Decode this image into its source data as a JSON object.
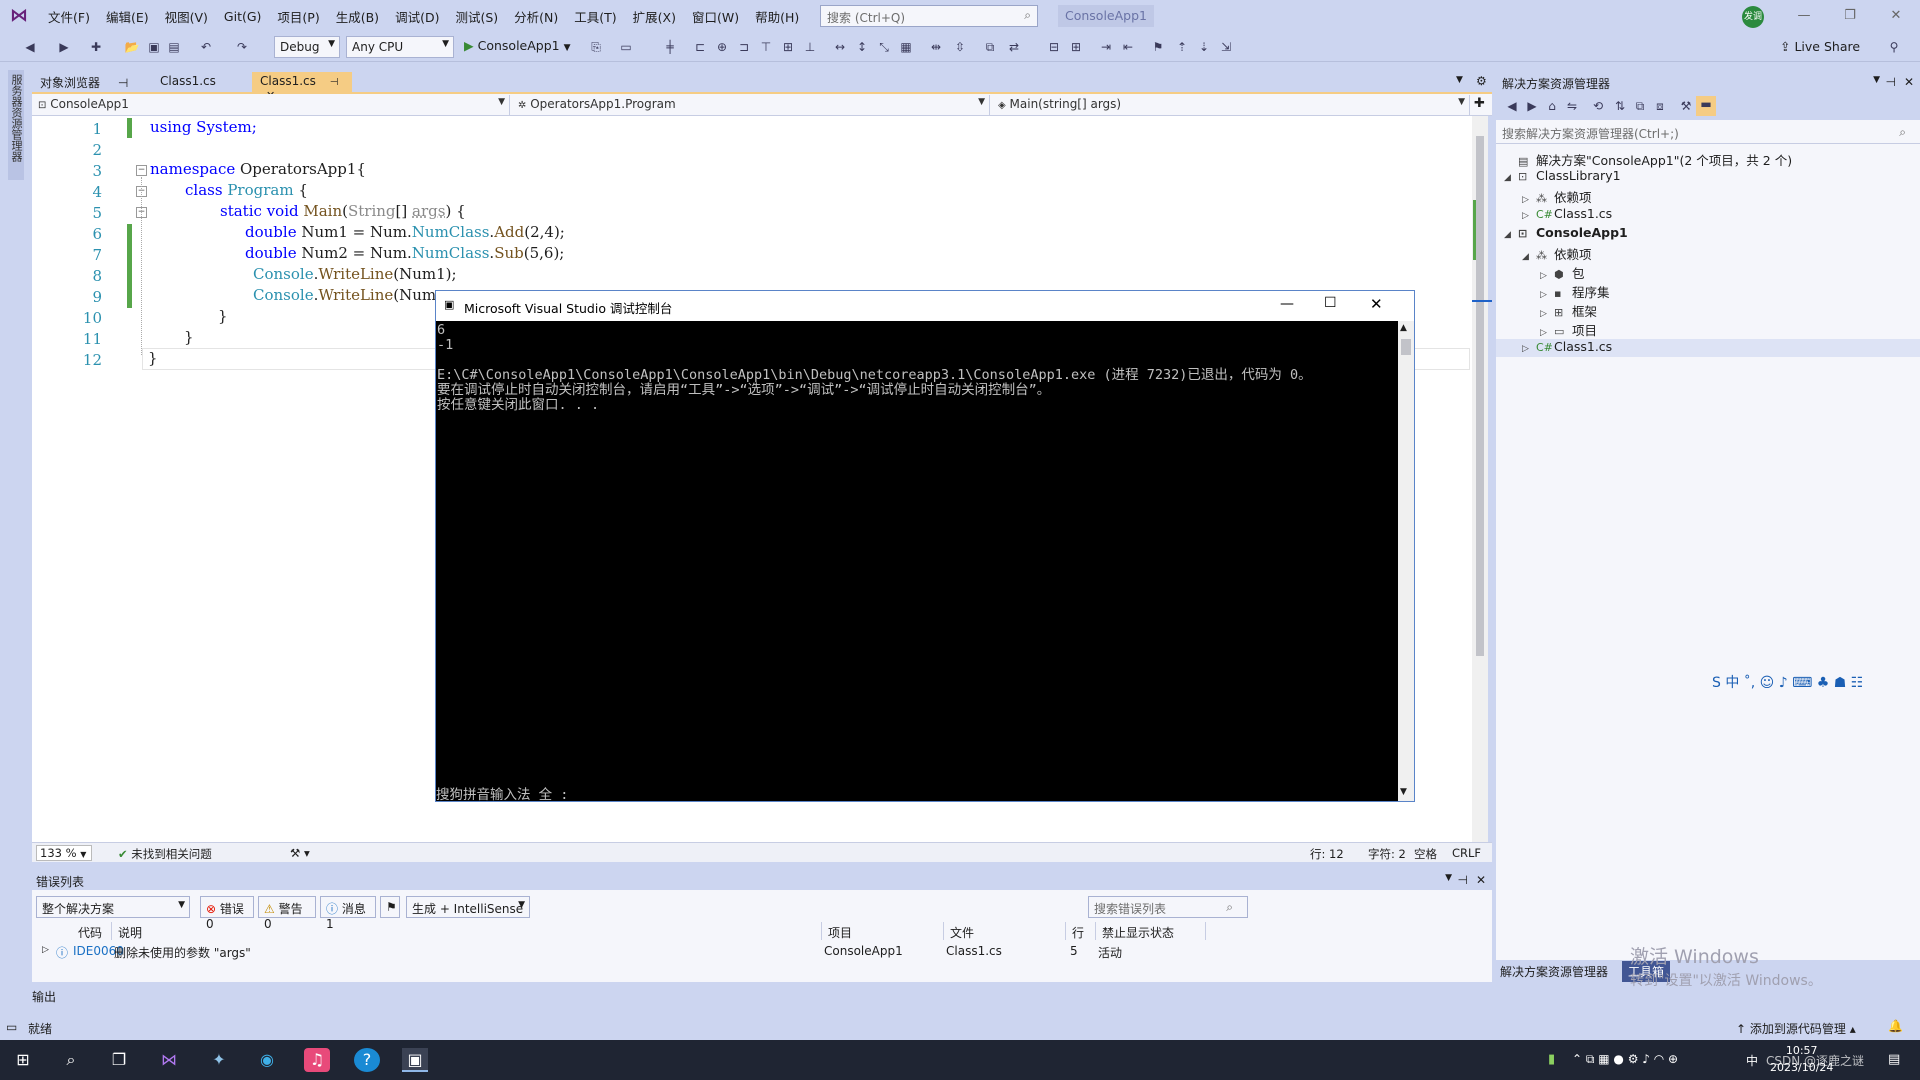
{
  "menubar": {
    "items": [
      "文件(F)",
      "编辑(E)",
      "视图(V)",
      "Git(G)",
      "项目(P)",
      "生成(B)",
      "调试(D)",
      "测试(S)",
      "分析(N)",
      "工具(T)",
      "扩展(X)",
      "窗口(W)",
      "帮助(H)"
    ],
    "search_placeholder": "搜索 (Ctrl+Q)",
    "app_title": "ConsoleApp1",
    "avatar_text": "发调"
  },
  "toolbar": {
    "config": "Debug",
    "platform": "Any CPU",
    "run_target": "ConsoleApp1",
    "live_share": "Live Share"
  },
  "left_rail": {
    "label": "服务器资源管理器"
  },
  "doc_tabs": [
    {
      "label": "对象浏览器",
      "pin": "ᵒ"
    },
    {
      "label": "Class1.cs"
    },
    {
      "label": "Class1.cs",
      "pin": "ᵒ",
      "close": "✕"
    }
  ],
  "nav": {
    "project": "ConsoleApp1",
    "class": "OperatorsApp1.Program",
    "member": "Main(string[] args)"
  },
  "code_lines": [
    "1",
    "2",
    "3",
    "4",
    "5",
    "6",
    "7",
    "8",
    "9",
    "10",
    "11",
    "12"
  ],
  "code": {
    "l1": "using System;",
    "l3_kw": "namespace",
    "l3_rest": " OperatorsApp1{",
    "l4_kw": "class",
    "l4_ty": "Program",
    "l4_rest": " {",
    "l5_kw1": "static",
    "l5_kw2": "void",
    "l5_me": "Main",
    "l5_p1": "(",
    "l5_ty": "String",
    "l5_p2": "[] ",
    "l5_pa": "args",
    "l5_p3": ") {",
    "l6_kw": "double",
    "l6_rest1": " Num1 = Num.",
    "l6_ty": "NumClass",
    "l6_p": ".",
    "l6_me": "Add",
    "l6_rest2": "(2,4);",
    "l7_kw": "double",
    "l7_rest1": " Num2 = Num.",
    "l7_ty": "NumClass",
    "l7_p": ".",
    "l7_me": "Sub",
    "l7_rest2": "(5,6);",
    "l8_ty": "Console",
    "l8_p": ".",
    "l8_me": "WriteLine",
    "l8_rest": "(Num1);",
    "l9_ty": "Console",
    "l9_p": ".",
    "l9_me": "WriteLine",
    "l9_rest": "(Num",
    "l10": "}",
    "l11": "}",
    "l12": "}"
  },
  "editor_status": {
    "zoom": "133 %",
    "issues": "未找到相关问题",
    "line": "行: 12",
    "char": "字符: 2",
    "space": "空格",
    "eol": "CRLF"
  },
  "console": {
    "title": "Microsoft Visual Studio 调试控制台",
    "output": "6\n-1\n\nE:\\C#\\ConsoleApp1\\ConsoleApp1\\ConsoleApp1\\bin\\Debug\\netcoreapp3.1\\ConsoleApp1.exe (进程 7232)已退出，代码为 0。\n要在调试停止时自动关闭控制台，请启用“工具”->“选项”->“调试”->“调试停止时自动关闭控制台”。\n按任意键关闭此窗口. . .",
    "ime_line": "搜狗拼音输入法 全 :"
  },
  "error_list": {
    "title": "错误列表",
    "scope": "整个解决方案",
    "errors": "错误 0",
    "warnings": "警告 0",
    "messages": "消息 1",
    "build_filter": "生成 + IntelliSense",
    "search_placeholder": "搜索错误列表",
    "columns": [
      "代码",
      "说明",
      "项目",
      "文件",
      "行",
      "禁止显示状态"
    ],
    "row": {
      "code": "IDE0060",
      "desc": "删除未使用的参数 \"args\"",
      "project": "ConsoleApp1",
      "file": "Class1.cs",
      "line": "5",
      "state": "活动"
    }
  },
  "output_tab": "输出",
  "solution": {
    "title": "解决方案资源管理器",
    "search_placeholder": "搜索解决方案资源管理器(Ctrl+;)",
    "tree": {
      "solution": "解决方案\"ConsoleApp1\"(2 个项目，共 2 个)",
      "lib": "ClassLibrary1",
      "lib_deps": "依赖项",
      "lib_class": "Class1.cs",
      "app": "ConsoleApp1",
      "app_deps": "依赖项",
      "pkg": "包",
      "asm": "程序集",
      "fw": "框架",
      "proj": "项目",
      "app_class": "Class1.cs"
    },
    "bottom_tabs": [
      "解决方案资源管理器",
      "工具箱"
    ]
  },
  "activate": {
    "line1": "激活 Windows",
    "line2": "转到\"设置\"以激活 Windows。"
  },
  "ime_bar": "S 中 ˚, ☺ ♪ ⌨ ♣ ☗ ☷",
  "statusbar": {
    "ready": "就绪",
    "source_control": "添加到源代码管理"
  },
  "taskbar": {
    "time": "10:57",
    "date": "2023/10/24",
    "csdn": "CSDN @逐鹿之谜",
    "lang": "中"
  }
}
